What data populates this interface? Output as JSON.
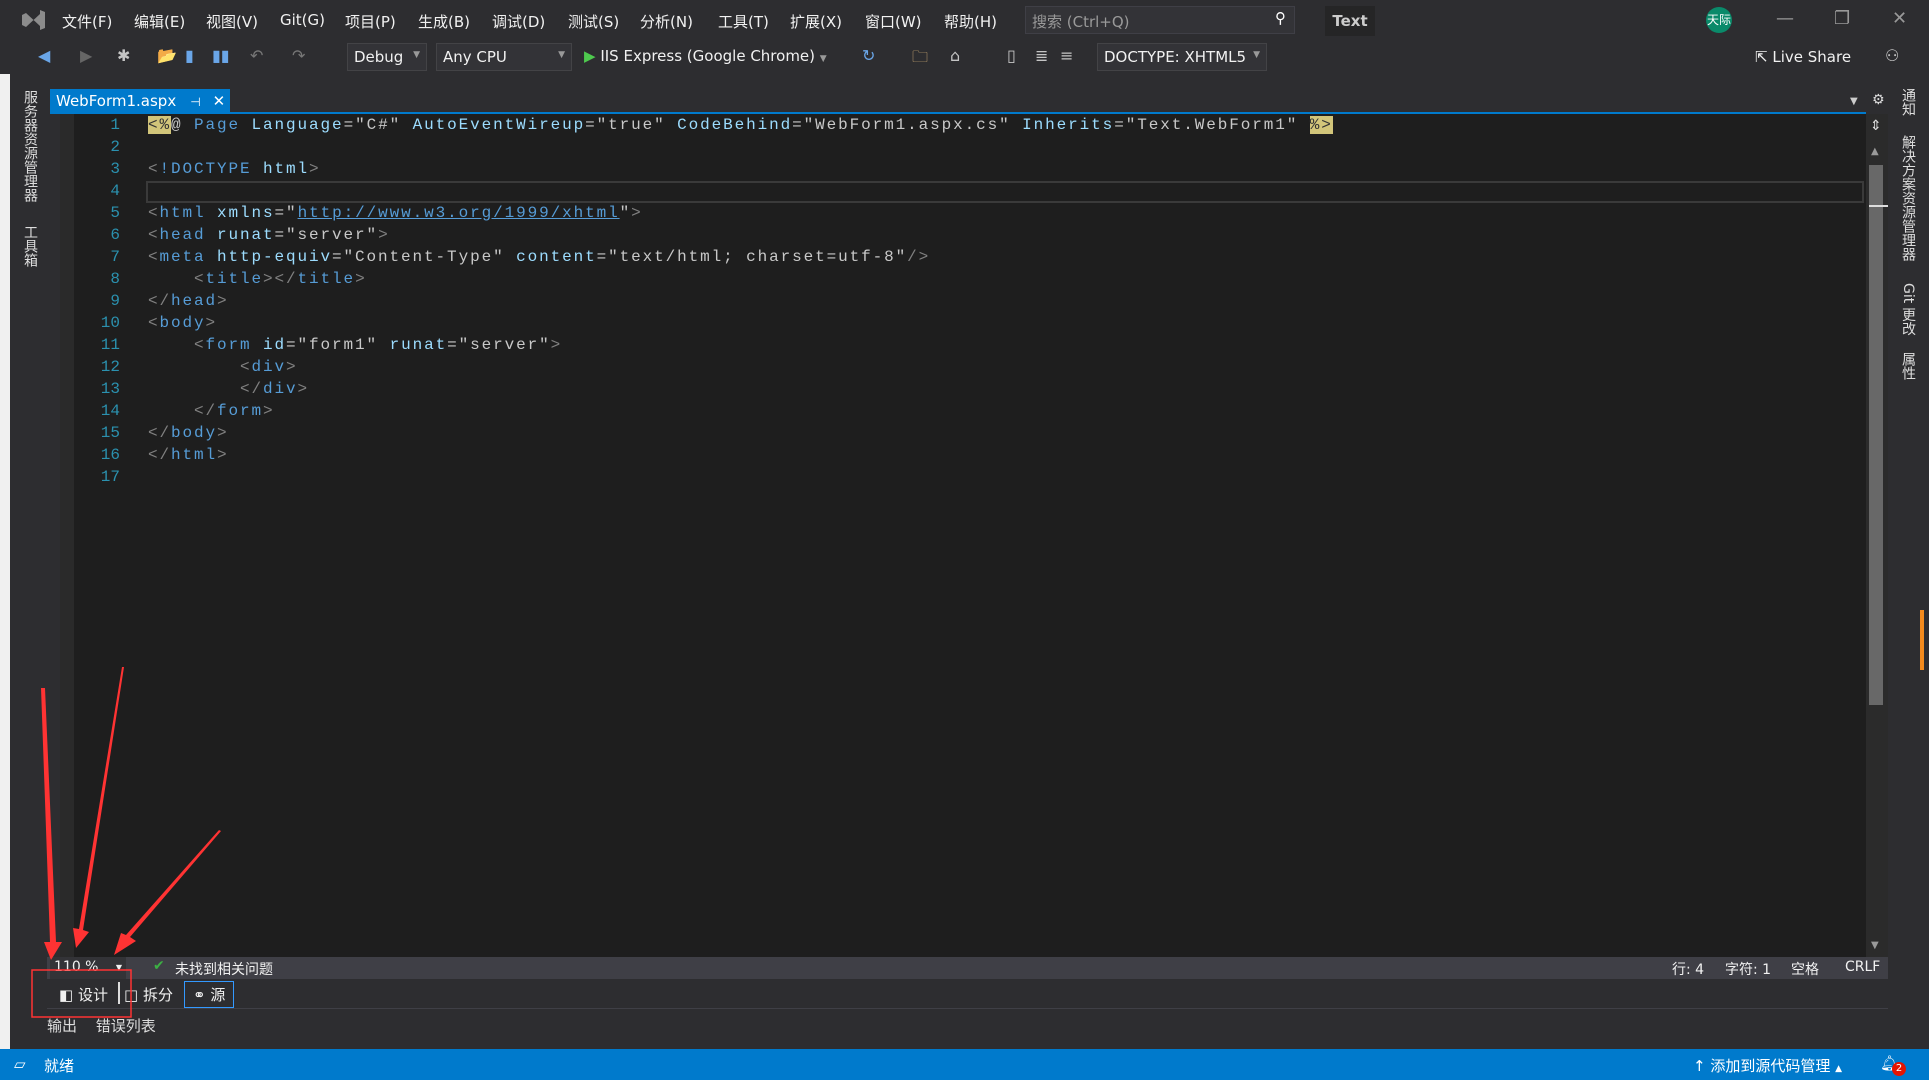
{
  "titlebar": {
    "menu": [
      "文件(F)",
      "编辑(E)",
      "视图(V)",
      "Git(G)",
      "项目(P)",
      "生成(B)",
      "调试(D)",
      "测试(S)",
      "分析(N)",
      "工具(T)",
      "扩展(X)",
      "窗口(W)",
      "帮助(H)"
    ],
    "search_placeholder": "搜索 (Ctrl+Q)",
    "solution_name": "Text",
    "avatar_initials": "天际"
  },
  "toolbar": {
    "configuration": "Debug",
    "platform": "Any CPU",
    "run_target": "IIS Express (Google Chrome)",
    "doctype": "DOCTYPE: XHTML5",
    "live_share": "Live Share"
  },
  "left_panels": [
    "服务器资源管理器",
    "工具箱"
  ],
  "right_panels": [
    "通知",
    "解决方案资源管理器",
    "Git 更改",
    "属性"
  ],
  "tab": {
    "filename": "WebForm1.aspx"
  },
  "editor": {
    "current_line": 4,
    "lines": [
      [
        [
          "<%",
          "t-dir"
        ],
        [
          "@ ",
          "t-txt"
        ],
        [
          "Page ",
          "t-tag"
        ],
        [
          "Language",
          "t-attr"
        ],
        [
          "=\"C#\" ",
          "t-val"
        ],
        [
          "AutoEventWireup",
          "t-attr"
        ],
        [
          "=\"true\" ",
          "t-val"
        ],
        [
          "CodeBehind",
          "t-attr"
        ],
        [
          "=\"WebForm1.aspx.cs\" ",
          "t-val"
        ],
        [
          "Inherits",
          "t-attr"
        ],
        [
          "=\"Text.WebForm1\" ",
          "t-val"
        ],
        [
          "%>",
          "t-dir"
        ]
      ],
      [],
      [
        [
          "<",
          "t-br"
        ],
        [
          "!DOCTYPE ",
          "t-tag"
        ],
        [
          "html",
          "t-attr"
        ],
        [
          ">",
          "t-br"
        ]
      ],
      [],
      [
        [
          "<",
          "t-br"
        ],
        [
          "html ",
          "t-tag"
        ],
        [
          "xmlns",
          "t-attr"
        ],
        [
          "=\"",
          "t-val"
        ],
        [
          "http://www.w3.org/1999/xhtml",
          "t-link"
        ],
        [
          "\"",
          "t-val"
        ],
        [
          ">",
          "t-br"
        ]
      ],
      [
        [
          "<",
          "t-br"
        ],
        [
          "head ",
          "t-tag"
        ],
        [
          "runat",
          "t-attr"
        ],
        [
          "=\"server\"",
          "t-val"
        ],
        [
          ">",
          "t-br"
        ]
      ],
      [
        [
          "<",
          "t-br"
        ],
        [
          "meta ",
          "t-tag"
        ],
        [
          "http-equiv",
          "t-attr"
        ],
        [
          "=\"Content-Type\" ",
          "t-val"
        ],
        [
          "content",
          "t-attr"
        ],
        [
          "=\"text/html; charset=utf-8\"",
          "t-val"
        ],
        [
          "/>",
          "t-br"
        ]
      ],
      [
        [
          "    <",
          "t-br"
        ],
        [
          "title",
          "t-tag"
        ],
        [
          "></",
          "t-br"
        ],
        [
          "title",
          "t-tag"
        ],
        [
          ">",
          "t-br"
        ]
      ],
      [
        [
          "</",
          "t-br"
        ],
        [
          "head",
          "t-tag"
        ],
        [
          ">",
          "t-br"
        ]
      ],
      [
        [
          "<",
          "t-br"
        ],
        [
          "body",
          "t-tag"
        ],
        [
          ">",
          "t-br"
        ]
      ],
      [
        [
          "    <",
          "t-br"
        ],
        [
          "form ",
          "t-tag"
        ],
        [
          "id",
          "t-attr"
        ],
        [
          "=\"form1\" ",
          "t-val"
        ],
        [
          "runat",
          "t-attr"
        ],
        [
          "=\"server\"",
          "t-val"
        ],
        [
          ">",
          "t-br"
        ]
      ],
      [
        [
          "        <",
          "t-br"
        ],
        [
          "div",
          "t-tag"
        ],
        [
          ">",
          "t-br"
        ]
      ],
      [
        [
          "        </",
          "t-br"
        ],
        [
          "div",
          "t-tag"
        ],
        [
          ">",
          "t-br"
        ]
      ],
      [
        [
          "    </",
          "t-br"
        ],
        [
          "form",
          "t-tag"
        ],
        [
          ">",
          "t-br"
        ]
      ],
      [
        [
          "</",
          "t-br"
        ],
        [
          "body",
          "t-tag"
        ],
        [
          ">",
          "t-br"
        ]
      ],
      [
        [
          "</",
          "t-br"
        ],
        [
          "html",
          "t-tag"
        ],
        [
          ">",
          "t-br"
        ]
      ],
      []
    ]
  },
  "editor_status": {
    "zoom": "110 %",
    "issues": "未找到相关问题",
    "line": "行: 4",
    "char": "字符: 1",
    "indent": "空格",
    "eol": "CRLF"
  },
  "view_modes": {
    "design": "设计",
    "split": "拆分",
    "source": "源",
    "active": "源"
  },
  "bottom_tabs": [
    "输出",
    "错误列表"
  ],
  "statusbar": {
    "ready": "就绪",
    "source_control": "添加到源代码管理",
    "notifications": "2"
  },
  "colors": {
    "accent": "#007acc",
    "annotation": "#ff3333"
  }
}
